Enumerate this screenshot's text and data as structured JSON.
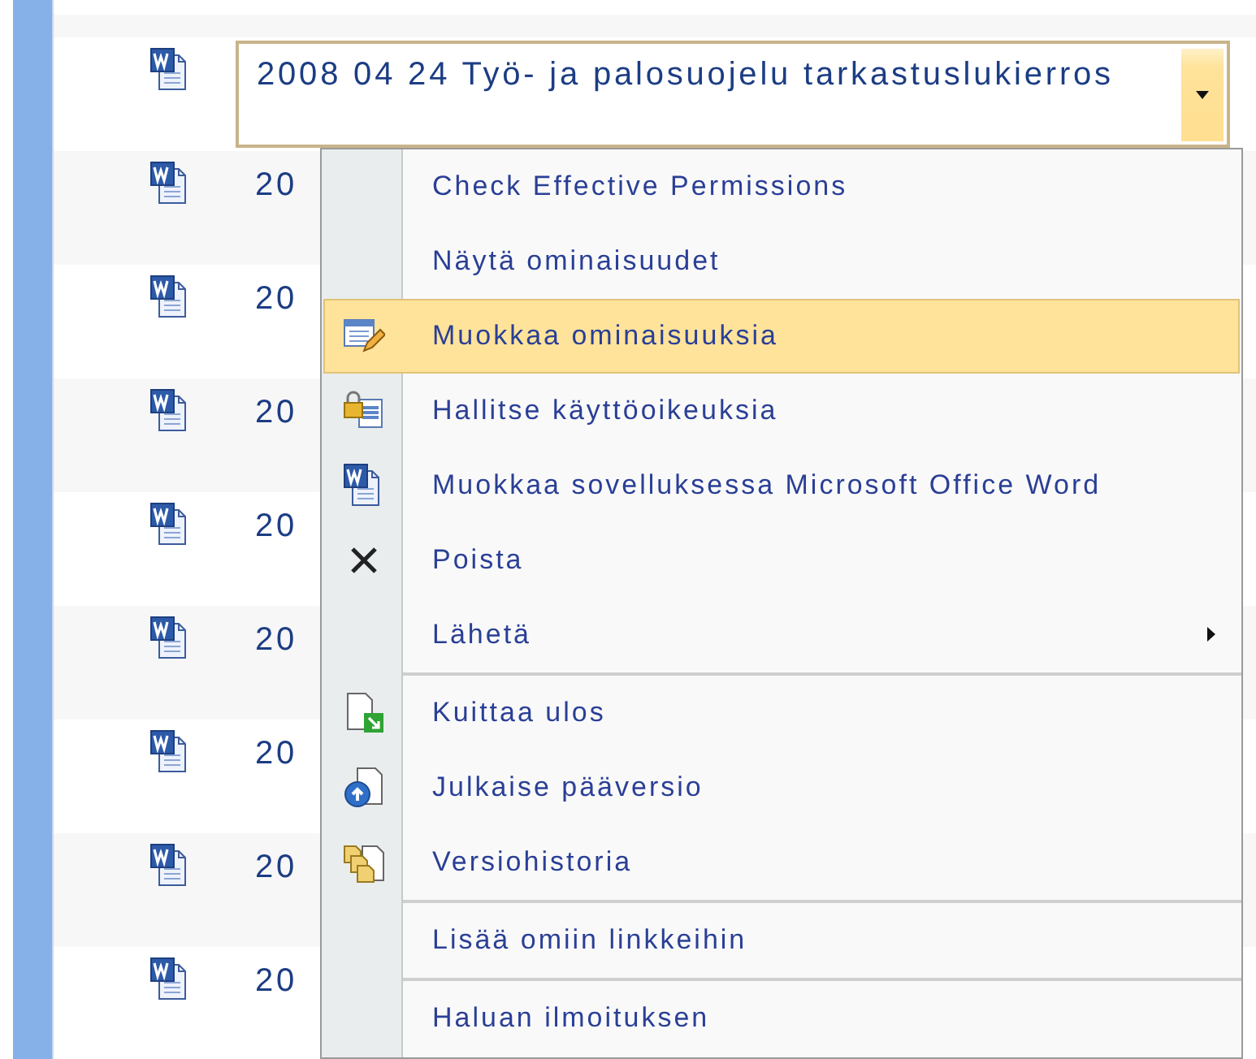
{
  "rows": [
    {
      "title": "2008 04 24 Työ- ja palosuojelu tarkastuslukierros",
      "selected": true
    },
    {
      "title": "20",
      "selected": false
    },
    {
      "title": "20",
      "selected": false
    },
    {
      "title": "20",
      "selected": false
    },
    {
      "title": "20",
      "selected": false
    },
    {
      "title": "20",
      "selected": false
    },
    {
      "title": "20",
      "selected": false
    },
    {
      "title": "20",
      "selected": false
    },
    {
      "title": "20",
      "selected": false
    }
  ],
  "menu": {
    "items": [
      {
        "label": "Check Effective Permissions",
        "selected": false,
        "separator_before": false,
        "submenu": false
      },
      {
        "label": "Näytä ominaisuudet",
        "selected": false,
        "separator_before": false,
        "submenu": false
      },
      {
        "label": "Muokkaa ominaisuuksia",
        "selected": true,
        "separator_before": false,
        "submenu": false
      },
      {
        "label": "Hallitse käyttöoikeuksia",
        "selected": false,
        "separator_before": false,
        "submenu": false
      },
      {
        "label": "Muokkaa sovelluksessa Microsoft Office Word",
        "selected": false,
        "separator_before": false,
        "submenu": false
      },
      {
        "label": "Poista",
        "selected": false,
        "separator_before": false,
        "submenu": false
      },
      {
        "label": "Lähetä",
        "selected": false,
        "separator_before": false,
        "submenu": true
      },
      {
        "label": "Kuittaa ulos",
        "selected": false,
        "separator_before": true,
        "submenu": false
      },
      {
        "label": "Julkaise pääversio",
        "selected": false,
        "separator_before": false,
        "submenu": false
      },
      {
        "label": "Versiohistoria",
        "selected": false,
        "separator_before": false,
        "submenu": false
      },
      {
        "label": "Lisää omiin linkkeihin",
        "selected": false,
        "separator_before": true,
        "submenu": false
      },
      {
        "label": "Haluan ilmoituksen",
        "selected": false,
        "separator_before": true,
        "submenu": false
      }
    ]
  }
}
